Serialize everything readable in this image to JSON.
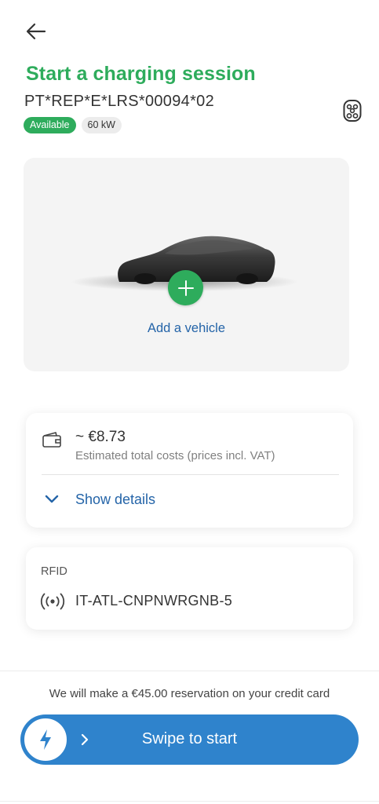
{
  "header": {
    "title": "Start a charging session",
    "evse_id": "PT*REP*E*LRS*00094*02",
    "badges": {
      "status": "Available",
      "power": "60 kW"
    }
  },
  "vehicle": {
    "add_label": "Add a vehicle"
  },
  "cost": {
    "value": "~ €8.73",
    "description": "Estimated total costs (prices incl. VAT)",
    "details_label": "Show details"
  },
  "rfid": {
    "title": "RFID",
    "value": "IT-ATL-CNPNWRGNB-5"
  },
  "footer": {
    "reservation_note": "We will make a €45.00 reservation on your credit card",
    "swipe_label": "Swipe to start"
  },
  "colors": {
    "accent_green": "#2eac5c",
    "link_blue": "#2464a8",
    "swipe_blue": "#2f83cc"
  },
  "icons": [
    "back-arrow-icon",
    "ev-connector-icon",
    "car-image",
    "plus-icon",
    "wallet-icon",
    "chevron-down-icon",
    "rfid-signal-icon",
    "lightning-bolt-icon",
    "chevron-right-icon"
  ]
}
